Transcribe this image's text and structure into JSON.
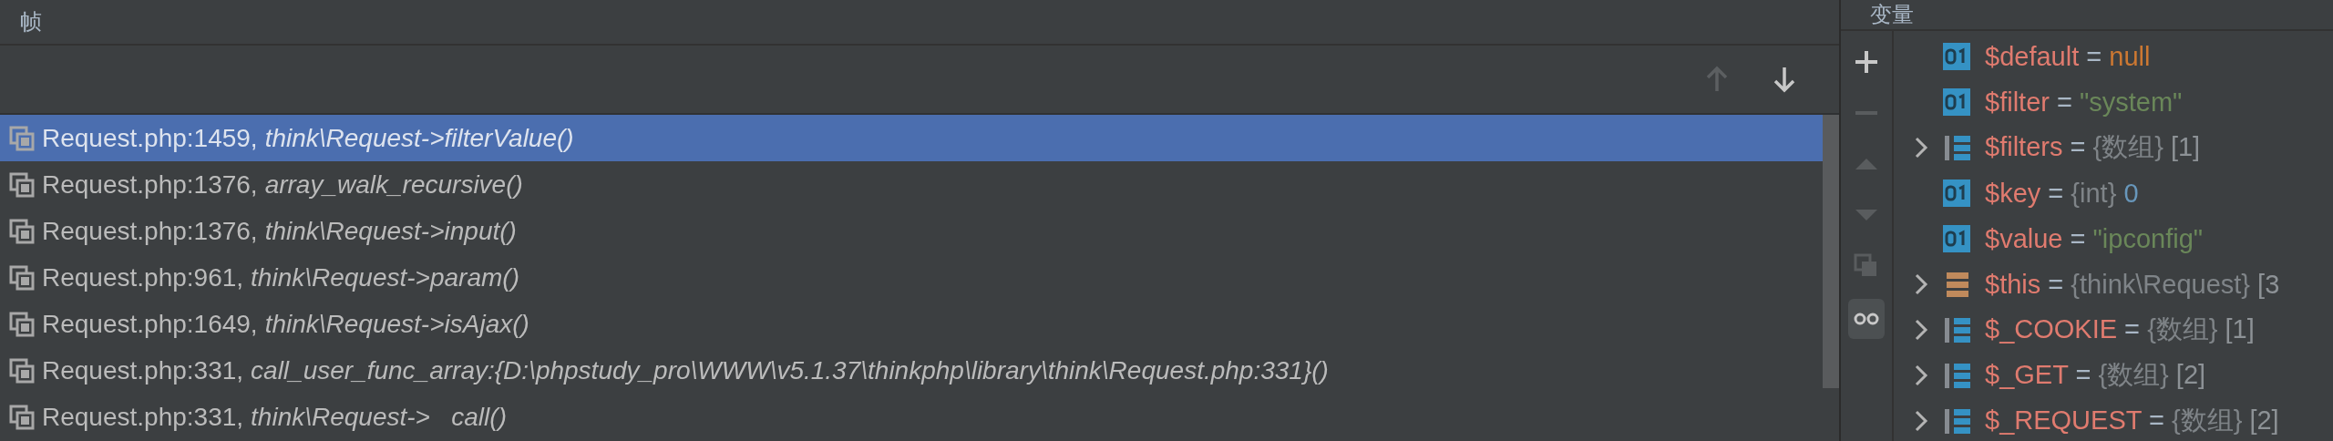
{
  "frames_panel": {
    "title": "帧",
    "nav": [
      {
        "kind": "up",
        "disabled": true
      },
      {
        "kind": "down",
        "disabled": false
      }
    ],
    "frames": [
      {
        "location": "Request.php:1459,",
        "method": "think\\Request->filterValue()",
        "selected": true
      },
      {
        "location": "Request.php:1376,",
        "method": "array_walk_recursive()",
        "selected": false
      },
      {
        "location": "Request.php:1376,",
        "method": "think\\Request->input()",
        "selected": false
      },
      {
        "location": "Request.php:961,",
        "method": "think\\Request->param()",
        "selected": false
      },
      {
        "location": "Request.php:1649,",
        "method": "think\\Request->isAjax()",
        "selected": false
      },
      {
        "location": "Request.php:331,",
        "method": "call_user_func_array:{D:\\phpstudy_pro\\WWW\\v5.1.37\\thinkphp\\library\\think\\Request.php:331}()",
        "selected": false
      },
      {
        "location": "Request.php:331,",
        "method": "think\\Request->   call()",
        "selected": false
      }
    ]
  },
  "variables_panel": {
    "title": "变量",
    "toolbar": [
      {
        "kind": "add",
        "disabled": false
      },
      {
        "kind": "remove",
        "disabled": true
      },
      {
        "kind": "up",
        "disabled": true
      },
      {
        "kind": "down",
        "disabled": true
      },
      {
        "kind": "copy",
        "disabled": true
      },
      {
        "kind": "watch",
        "disabled": false
      }
    ],
    "variables": [
      {
        "name": "$default",
        "kind": "scalar",
        "expandable": false,
        "separator": "=",
        "value": "null",
        "color": "#cc7832"
      },
      {
        "name": "$filter",
        "kind": "scalar",
        "expandable": false,
        "separator": "=",
        "value": "\"system\"",
        "color": "#6a8759"
      },
      {
        "name": "$filters",
        "kind": "array",
        "expandable": true,
        "separator": "=",
        "type": "{数组}",
        "value": "[1]",
        "color": "#8d9296"
      },
      {
        "name": "$key",
        "kind": "scalar",
        "expandable": false,
        "separator": "=",
        "type": "{int}",
        "value": "0",
        "color": "#6897bb"
      },
      {
        "name": "$value",
        "kind": "scalar",
        "expandable": false,
        "separator": "=",
        "value": "\"ipconfig\"",
        "color": "#6a8759"
      },
      {
        "name": "$this",
        "kind": "object",
        "expandable": true,
        "separator": "=",
        "type": "{think\\Request}",
        "value": "[3",
        "color": "#8d9296"
      },
      {
        "name": "$_COOKIE",
        "kind": "array",
        "expandable": true,
        "separator": "=",
        "type": "{数组}",
        "value": "[1]",
        "color": "#8d9296"
      },
      {
        "name": "$_GET",
        "kind": "array",
        "expandable": true,
        "separator": "=",
        "type": "{数组}",
        "value": "[2]",
        "color": "#8d9296"
      },
      {
        "name": "$_REQUEST",
        "kind": "array",
        "expandable": true,
        "separator": "=",
        "type": "{数组}",
        "value": "[2]",
        "color": "#8d9296"
      }
    ]
  }
}
